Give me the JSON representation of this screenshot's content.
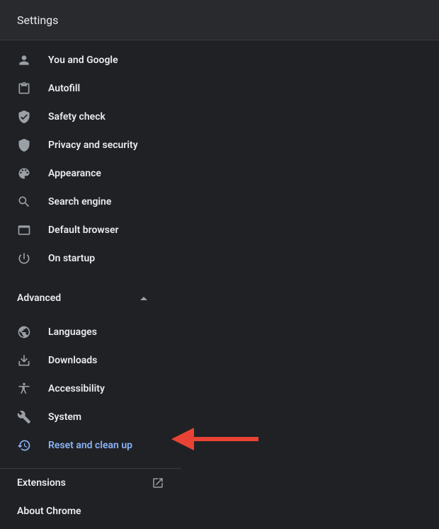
{
  "header": {
    "title": "Settings"
  },
  "sidebar": {
    "items": [
      {
        "label": "You and Google"
      },
      {
        "label": "Autofill"
      },
      {
        "label": "Safety check"
      },
      {
        "label": "Privacy and security"
      },
      {
        "label": "Appearance"
      },
      {
        "label": "Search engine"
      },
      {
        "label": "Default browser"
      },
      {
        "label": "On startup"
      }
    ],
    "advanced_label": "Advanced",
    "advanced_items": [
      {
        "label": "Languages"
      },
      {
        "label": "Downloads"
      },
      {
        "label": "Accessibility"
      },
      {
        "label": "System"
      },
      {
        "label": "Reset and clean up"
      }
    ],
    "footer": {
      "extensions": "Extensions",
      "about": "About Chrome"
    }
  }
}
